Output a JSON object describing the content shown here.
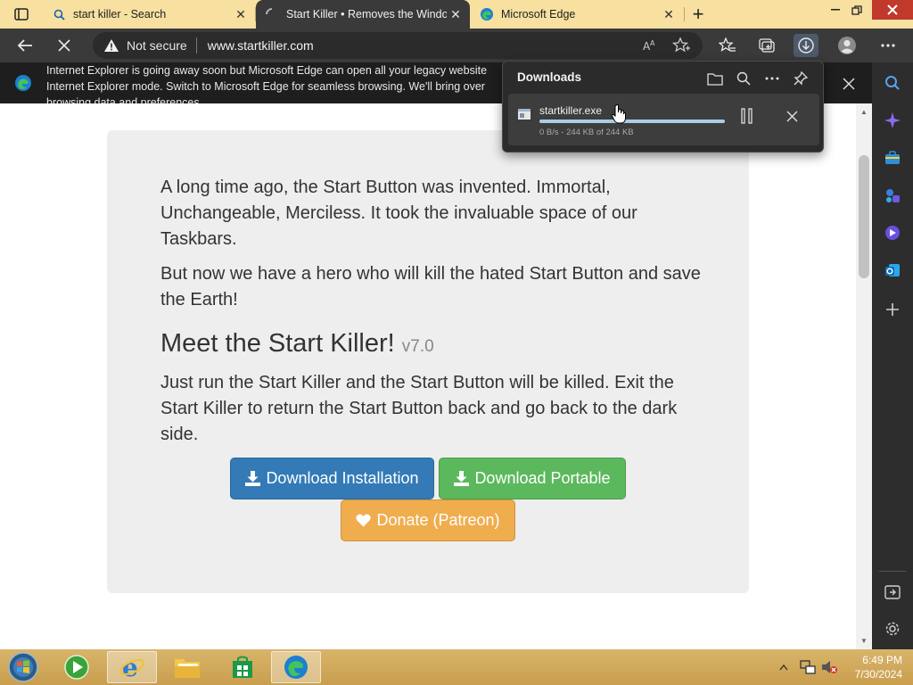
{
  "tabs": [
    {
      "title": "start killer - Search",
      "icon": "search-icon",
      "active": false
    },
    {
      "title": "Start Killer • Removes the Windo",
      "icon": "loading-icon",
      "active": true
    },
    {
      "title": "Microsoft Edge",
      "icon": "edge-icon",
      "active": false
    }
  ],
  "toolbar": {
    "security_label": "Not secure",
    "url": "www.startkiller.com"
  },
  "infobar": {
    "line1": "Internet Explorer is going away soon but Microsoft Edge can open all your legacy website",
    "line2": "Internet Explorer mode. Switch to Microsoft Edge for seamless browsing. We'll bring over",
    "line3": "browsing data and preferences."
  },
  "downloads": {
    "title": "Downloads",
    "items": [
      {
        "filename": "startkiller.exe",
        "status": "0 B/s - 244 KB of 244 KB",
        "progress": 1.0
      }
    ]
  },
  "page": {
    "para1": "A long time ago, the Start Button was invented. Immortal, Unchangeable, Merciless. It took the invaluable space of our Taskbars.",
    "para2": "But now we have a hero who will kill the hated Start Button and save the Earth!",
    "heading": "Meet the Start Killer!",
    "version": "v7.0",
    "para3": "Just run the Start Killer and the Start Button will be killed. Exit the Start Killer to return the Start Button back and go back to the dark side.",
    "buttons": {
      "install": "Download Installation",
      "portable": "Download Portable",
      "donate": "Donate (Patreon)"
    }
  },
  "taskbar": {
    "time": "6:49 PM",
    "date": "7/30/2024"
  },
  "colors": {
    "accent_blue": "#337ab7",
    "accent_green": "#5cb85c",
    "accent_orange": "#f0ad4e",
    "tabstrip": "#f7e0a0",
    "toolbar": "#3a3a3a"
  }
}
